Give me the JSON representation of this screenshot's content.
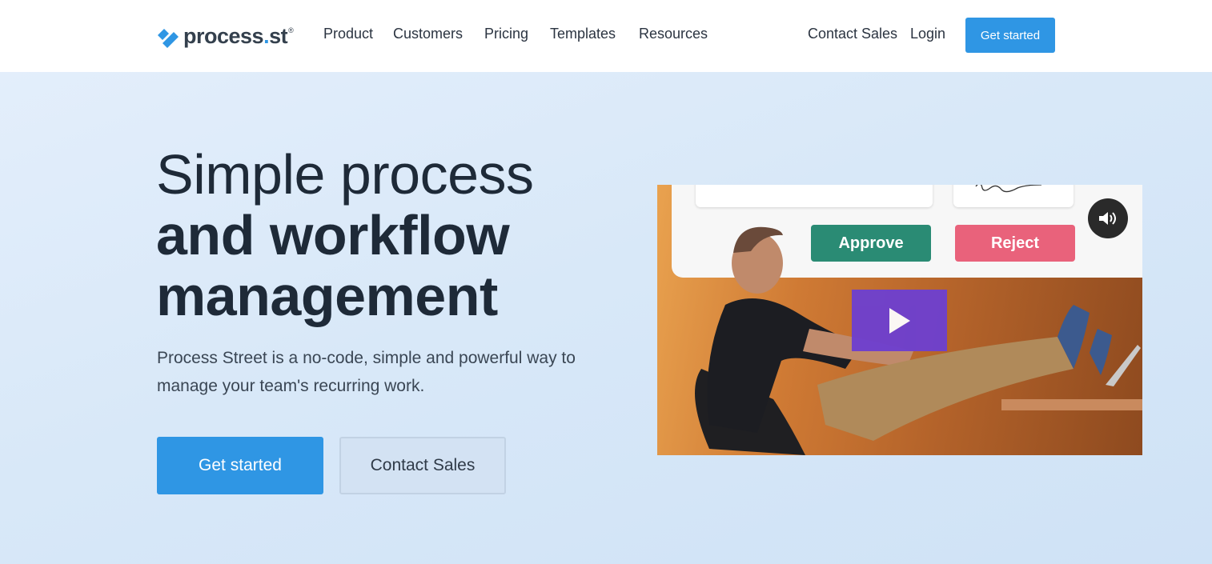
{
  "header": {
    "logo": {
      "name": "process",
      "dot": ".",
      "suffix": "st",
      "reg": "®"
    },
    "nav": [
      "Product",
      "Customers",
      "Pricing",
      "Templates",
      "Resources"
    ],
    "contact_sales": "Contact Sales",
    "login": "Login",
    "get_started": "Get started"
  },
  "hero": {
    "headline_line1": "Simple process",
    "headline_line2": "and workflow",
    "headline_line3": "management",
    "subtitle": "Process Street is a no-code, simple and powerful way to manage your team's recurring work.",
    "cta_primary": "Get started",
    "cta_secondary": "Contact Sales"
  },
  "video": {
    "approve_label": "Approve",
    "reject_label": "Reject",
    "sound_icon": "speaker-icon",
    "play_icon": "play-icon"
  },
  "colors": {
    "brand_blue": "#2f96e4",
    "approve_green": "#2a8b74",
    "reject_pink": "#e9627b",
    "play_purple": "#6d3fd1"
  }
}
